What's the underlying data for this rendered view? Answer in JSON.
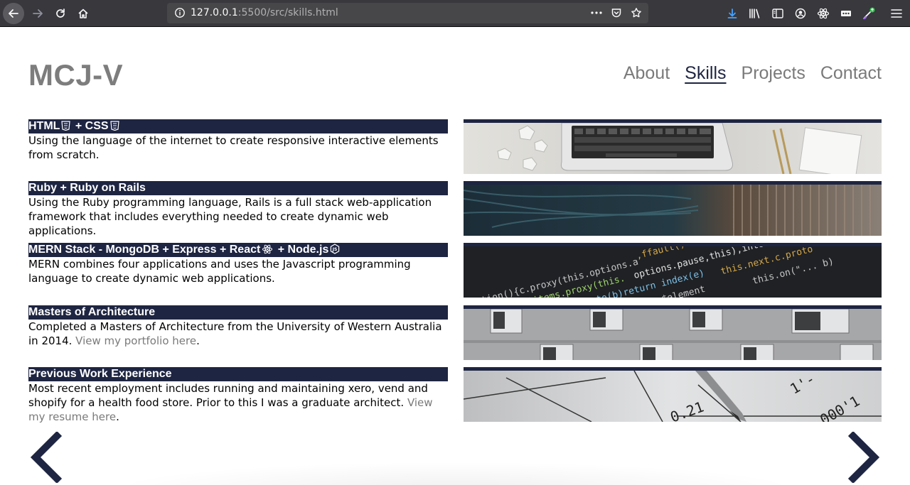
{
  "browser": {
    "url_host": "127.0.0.1",
    "url_path": ":5500/src/skills.html"
  },
  "site": {
    "logo": "MCJ-V",
    "nav": [
      {
        "label": "About"
      },
      {
        "label": "Skills"
      },
      {
        "label": "Projects"
      },
      {
        "label": "Contact"
      }
    ]
  },
  "skills": [
    {
      "title_a": "HTML",
      "title_b": " + CSS",
      "desc": "Using the language of the internet to create responsive interactive elements from scratch."
    },
    {
      "title": "Ruby + Ruby on Rails",
      "desc": "Using the Ruby programming language, Rails is a full stack web-application framework that includes everything needed to create dynamic web applications."
    },
    {
      "title_a": "MERN Stack - MongoDB + Express + React",
      "title_b": " + Node.js",
      "desc": "MERN combines four applications and uses the Javascript programming language to create dynamic web applications."
    },
    {
      "title": "Masters of Architecture",
      "desc": "Completed a Masters of Architecture from the University of Western Australia in 2014. ",
      "link": "View my portfolio here",
      "desc_end": "."
    },
    {
      "title": "Previous Work Experience",
      "desc": "Most recent employment includes running and maintaining xero, vend and shopify for a health food store. Prior to this I was a graduate architect. ",
      "link": "View my resume here",
      "desc_end": "."
    }
  ],
  "colors": {
    "accent": "#1e2542",
    "muted": "#7a7a7a",
    "chrome": "#38383d"
  },
  "icons": [
    "back-icon",
    "forward-icon",
    "reload-icon",
    "home-icon",
    "info-icon",
    "more-icon",
    "pocket-icon",
    "bookmark-star-icon",
    "download-icon",
    "library-icon",
    "sidebar-icon",
    "account-icon",
    "react-devtools-icon",
    "extensions-icon",
    "theme-icon",
    "menu-icon",
    "chevron-left-icon",
    "chevron-right-icon",
    "html5-icon",
    "css3-icon",
    "react-icon",
    "nodejs-icon"
  ]
}
